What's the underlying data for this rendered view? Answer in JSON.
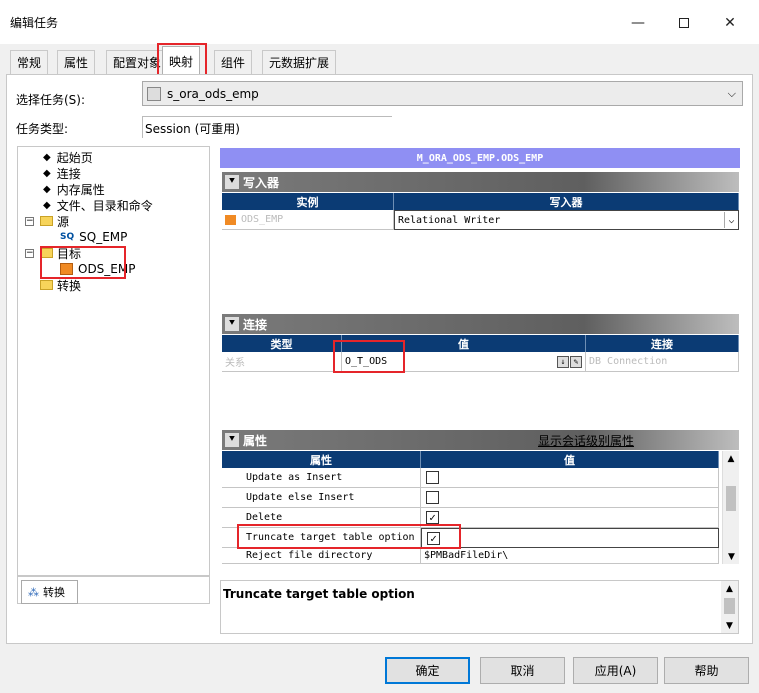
{
  "window": {
    "title": "编辑任务"
  },
  "tabs": [
    {
      "label": "常规"
    },
    {
      "label": "属性"
    },
    {
      "label": "配置对象"
    },
    {
      "label": "映射"
    },
    {
      "label": "组件"
    },
    {
      "label": "元数据扩展"
    }
  ],
  "form": {
    "select_task_label": "选择任务(S):",
    "select_task_value": "s_ora_ods_emp",
    "task_type_label": "任务类型:",
    "task_type_value": "Session (可重用)"
  },
  "tree": {
    "items": [
      {
        "label": "起始页"
      },
      {
        "label": "连接"
      },
      {
        "label": "内存属性"
      },
      {
        "label": "文件、目录和命令"
      },
      {
        "label": "源"
      },
      {
        "label": "SQ_EMP",
        "prefix": "SQ"
      },
      {
        "label": "目标"
      },
      {
        "label": "ODS_EMP"
      },
      {
        "label": "转换"
      }
    ],
    "bottom_tab": "转换"
  },
  "mapping": {
    "banner": "M_ORA_ODS_EMP.ODS_EMP",
    "writers": {
      "title": "写入器",
      "columns": [
        "实例",
        "写入器"
      ],
      "row": {
        "instance": "ODS_EMP",
        "writer": "Relational Writer"
      }
    },
    "connections": {
      "title": "连接",
      "columns": [
        "类型",
        "值",
        "连接"
      ],
      "row": {
        "type": "关系",
        "value": "O_T_ODS",
        "connection": "DB Connection"
      }
    },
    "properties": {
      "title": "属性",
      "link": "显示会话级别属性",
      "columns": [
        "属性",
        "值"
      ],
      "rows": [
        {
          "name": "Update as Insert",
          "checked": false
        },
        {
          "name": "Update else Insert",
          "checked": false
        },
        {
          "name": "Delete",
          "checked": true
        },
        {
          "name": "Truncate target table option",
          "checked": true
        },
        {
          "name": "Reject file directory",
          "value": "$PMBadFileDir\\"
        }
      ]
    },
    "description": "Truncate target table option"
  },
  "buttons": {
    "ok": "确定",
    "cancel": "取消",
    "apply": "应用(A)",
    "help": "帮助"
  }
}
